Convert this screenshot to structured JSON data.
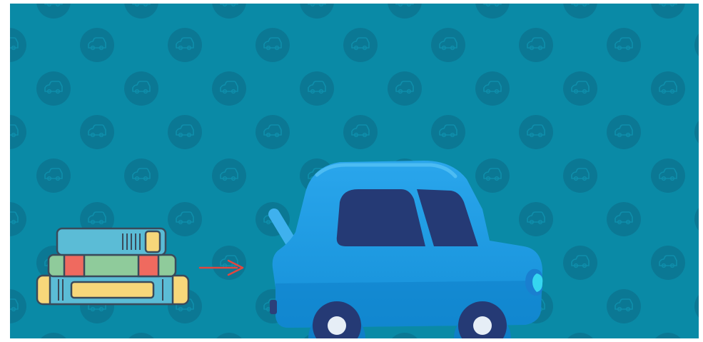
{
  "scene": {
    "background_color": "#0a8aa6",
    "pattern_circle_color": "#0b7894",
    "pattern_icon": "car-icon",
    "elements": [
      {
        "name": "book-stack-illustration",
        "icon": "books-icon"
      },
      {
        "name": "arrow-illustration",
        "icon": "arrow-right-icon",
        "color": "#e2463f"
      },
      {
        "name": "car-illustration",
        "icon": "hatchback-car-icon",
        "color": "#1d9be0"
      }
    ]
  }
}
